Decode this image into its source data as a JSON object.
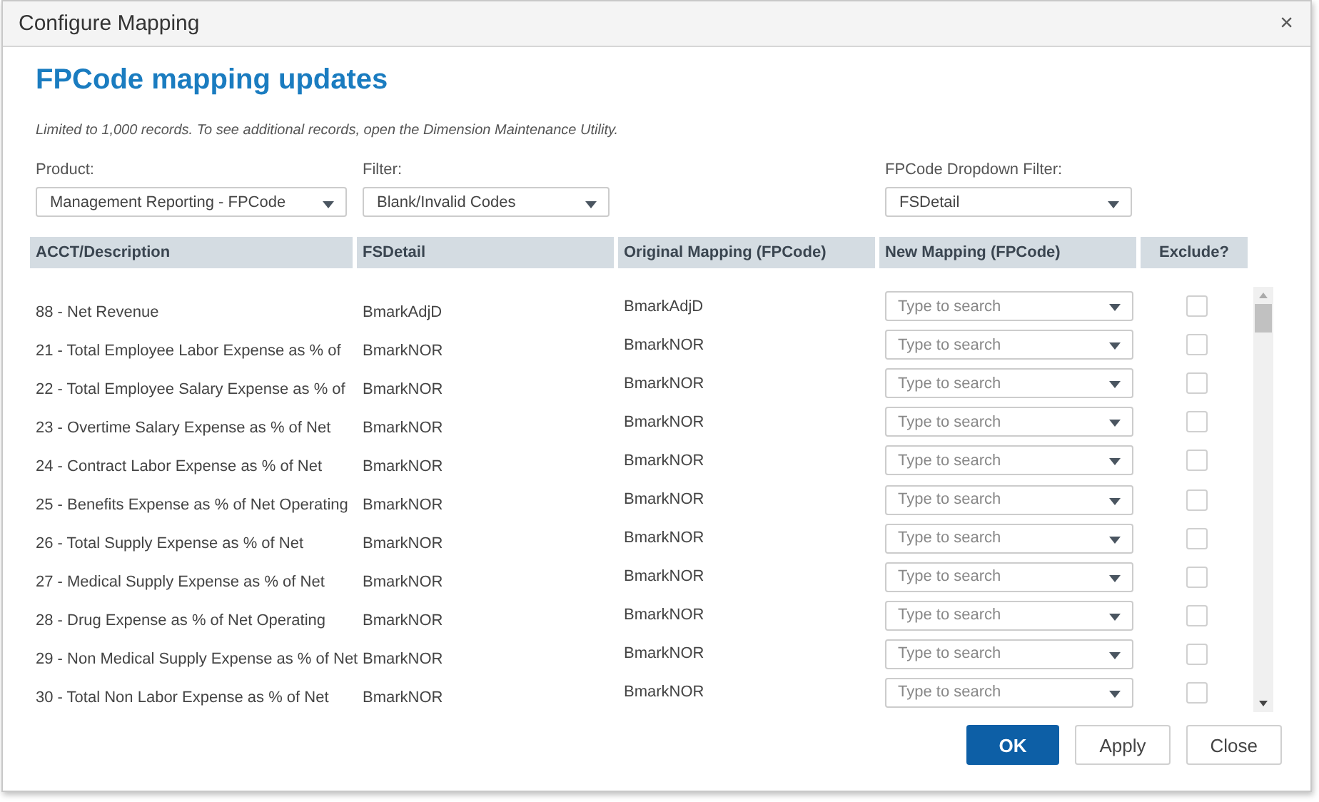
{
  "window": {
    "title": "Configure Mapping",
    "close": "×"
  },
  "heading": "FPCode mapping updates",
  "note": "Limited to 1,000 records. To see additional records, open the Dimension Maintenance Utility.",
  "filters": [
    {
      "label": "Product:",
      "value": "Management Reporting - FPCode"
    },
    {
      "label": "Filter:",
      "value": "Blank/Invalid Codes"
    },
    {
      "label": "FPCode Dropdown Filter:",
      "value": "FSDetail"
    }
  ],
  "table": {
    "columns": [
      "ACCT/Description",
      "FSDetail",
      "Original Mapping (FPCode)",
      "New Mapping (FPCode)",
      "Exclude?"
    ],
    "rows": [
      {
        "description": "88 - Net Revenue",
        "fsdetail": "BmarkAdjD",
        "original": "BmarkAdjD",
        "placeholder": "Type to search",
        "excluded": false
      },
      {
        "description": "21 - Total Employee Labor Expense as % of",
        "fsdetail": "BmarkNOR",
        "original": "BmarkNOR",
        "placeholder": "Type to search",
        "excluded": false
      },
      {
        "description": "22 - Total Employee Salary Expense as % of",
        "fsdetail": "BmarkNOR",
        "original": "BmarkNOR",
        "placeholder": "Type to search",
        "excluded": false
      },
      {
        "description": "23 - Overtime Salary Expense as % of Net",
        "fsdetail": "BmarkNOR",
        "original": "BmarkNOR",
        "placeholder": "Type to search",
        "excluded": false
      },
      {
        "description": "24 - Contract Labor Expense as % of Net",
        "fsdetail": "BmarkNOR",
        "original": "BmarkNOR",
        "placeholder": "Type to search",
        "excluded": false
      },
      {
        "description": "25 - Benefits Expense as % of Net Operating",
        "fsdetail": "BmarkNOR",
        "original": "BmarkNOR",
        "placeholder": "Type to search",
        "excluded": false
      },
      {
        "description": "26 - Total Supply Expense as % of Net",
        "fsdetail": "BmarkNOR",
        "original": "BmarkNOR",
        "placeholder": "Type to search",
        "excluded": false
      },
      {
        "description": "27 - Medical Supply Expense as % of Net",
        "fsdetail": "BmarkNOR",
        "original": "BmarkNOR",
        "placeholder": "Type to search",
        "excluded": false
      },
      {
        "description": "28 - Drug Expense as % of Net Operating",
        "fsdetail": "BmarkNOR",
        "original": "BmarkNOR",
        "placeholder": "Type to search",
        "excluded": false
      },
      {
        "description": "29 - Non Medical Supply Expense as % of Net",
        "fsdetail": "BmarkNOR",
        "original": "BmarkNOR",
        "placeholder": "Type to search",
        "excluded": false
      },
      {
        "description": "30 - Total Non Labor Expense as % of Net",
        "fsdetail": "BmarkNOR",
        "original": "BmarkNOR",
        "placeholder": "Type to search",
        "excluded": false
      }
    ]
  },
  "buttons": [
    {
      "label": "OK",
      "primary": true
    },
    {
      "label": "Apply",
      "primary": false
    },
    {
      "label": "Close",
      "primary": false
    }
  ]
}
